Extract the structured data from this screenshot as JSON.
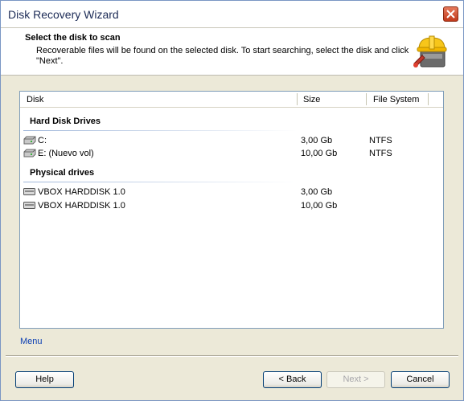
{
  "window": {
    "title": "Disk Recovery Wizard"
  },
  "header": {
    "title": "Select the disk to scan",
    "description": "Recoverable files will be found on the selected disk. To start searching, select the disk and click \"Next\"."
  },
  "list": {
    "columns": [
      "Disk",
      "Size",
      "File System"
    ],
    "groups": [
      {
        "label": "Hard Disk Drives",
        "rows": [
          {
            "name": "C:",
            "size": "3,00 Gb",
            "fs": "NTFS",
            "icon": "drive-icon"
          },
          {
            "name": "E: (Nuevo vol)",
            "size": "10,00 Gb",
            "fs": "NTFS",
            "icon": "drive-icon"
          }
        ]
      },
      {
        "label": "Physical drives",
        "rows": [
          {
            "name": "VBOX HARDDISK 1.0",
            "size": "3,00 Gb",
            "fs": "",
            "icon": "physical-disk-icon"
          },
          {
            "name": "VBOX HARDDISK 1.0",
            "size": "10,00 Gb",
            "fs": "",
            "icon": "physical-disk-icon"
          }
        ]
      }
    ]
  },
  "menu_link": "Menu",
  "buttons": {
    "help": "Help",
    "back": "< Back",
    "next": "Next >",
    "cancel": "Cancel"
  }
}
